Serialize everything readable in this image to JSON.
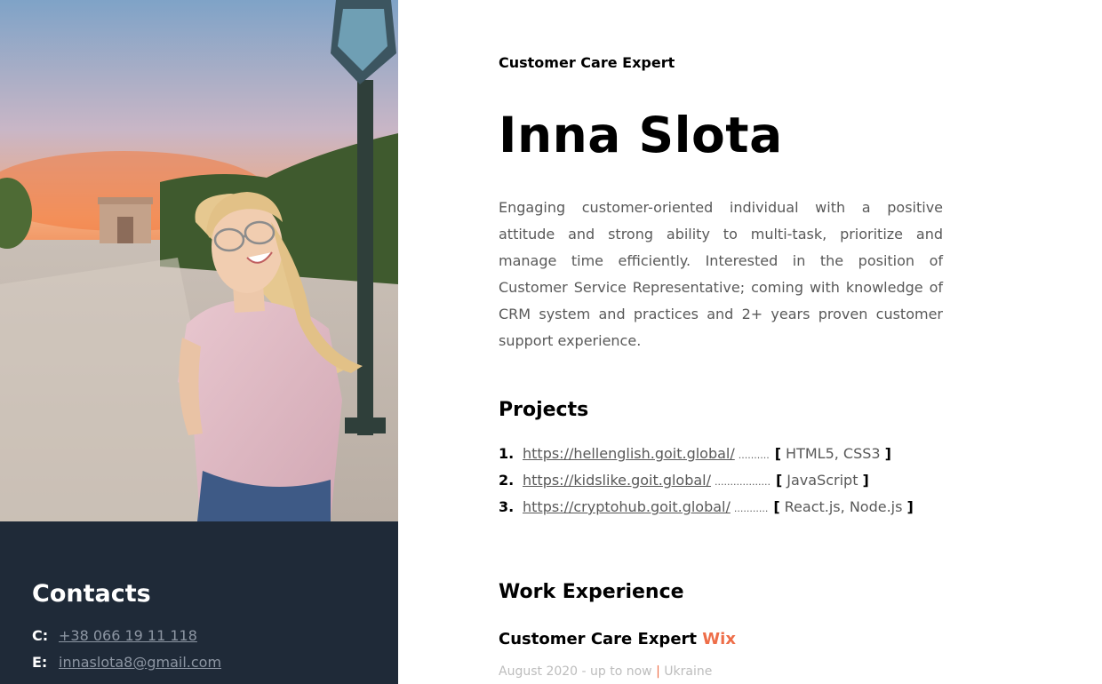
{
  "contacts": {
    "title": "Contacts",
    "phone_key": "C:",
    "phone": "+38 066 19 11 118",
    "email_key": "E:",
    "email": "innaslota8@gmail.com"
  },
  "header": {
    "job_title": "Customer Care Expert",
    "name": "Inna Slota"
  },
  "summary": "Engaging customer-oriented individual with a positive attitude and strong ability to multi-task, prioritize and manage time efficiently. Interested in the position of Customer Service Representative; coming with knowledge of CRM system and practices and 2+ years proven customer support experience.",
  "projects": {
    "title": "Projects",
    "items": [
      {
        "num": "1.",
        "url": "https://hellenglish.goit.global/",
        "dots": "..........",
        "open": "[",
        "tech": "HTML5, CSS3",
        "close": "]"
      },
      {
        "num": "2.",
        "url": "https://kidslike.goit.global/",
        "dots": "..................",
        "open": "[",
        "tech": "JavaScript",
        "close": "]"
      },
      {
        "num": "3.",
        "url": "https://cryptohub.goit.global/",
        "dots": "...........",
        "open": "[",
        "tech": "React.js, Node.js",
        "close": "]"
      }
    ]
  },
  "work": {
    "title": "Work Experience",
    "job_role": "Customer Care Expert",
    "job_company": "Wix",
    "job_period": "August 2020 - up to now",
    "job_separator": "|",
    "job_location": "Ukraine"
  },
  "colors": {
    "contacts_bg": "#1f2a38",
    "accent": "#ee6e49",
    "text_muted": "#595959"
  }
}
